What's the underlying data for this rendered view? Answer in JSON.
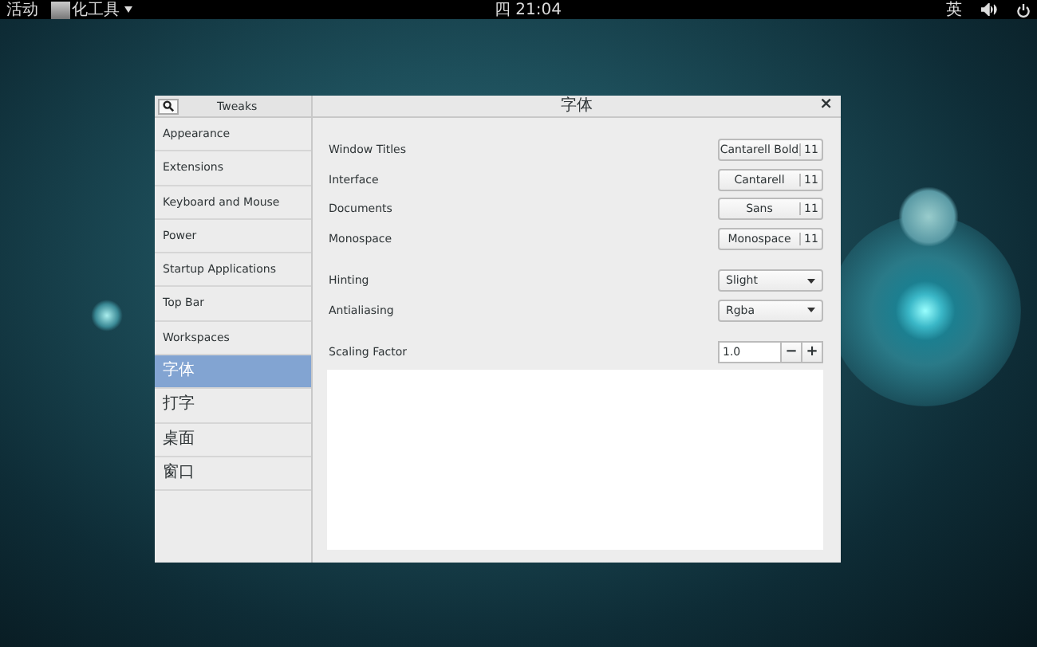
{
  "top_bar": {
    "activities": "活动",
    "app_menu": "化工具",
    "clock": "四 21:04",
    "input_method": "英"
  },
  "window": {
    "sidebar_title": "Tweaks",
    "title": "字体",
    "close": "×"
  },
  "sidebar": {
    "items": [
      {
        "label": "Appearance",
        "selected": false
      },
      {
        "label": "Extensions",
        "selected": false
      },
      {
        "label": "Keyboard and Mouse",
        "selected": false
      },
      {
        "label": "Power",
        "selected": false
      },
      {
        "label": "Startup Applications",
        "selected": false
      },
      {
        "label": "Top Bar",
        "selected": false
      },
      {
        "label": "Workspaces",
        "selected": false
      },
      {
        "label": "字体",
        "selected": true
      },
      {
        "label": "打字",
        "selected": false
      },
      {
        "label": "桌面",
        "selected": false
      },
      {
        "label": "窗口",
        "selected": false
      }
    ]
  },
  "settings": [
    {
      "kind": "font",
      "label": "Window Titles",
      "font": "Cantarell Bold",
      "size": "11"
    },
    {
      "kind": "font",
      "label": "Interface",
      "font": "Cantarell",
      "size": "11"
    },
    {
      "kind": "font",
      "label": "Documents",
      "font": "Sans",
      "size": "11"
    },
    {
      "kind": "font",
      "label": "Monospace",
      "font": "Monospace",
      "size": "11"
    },
    {
      "kind": "gap"
    },
    {
      "kind": "dropdown",
      "label": "Hinting",
      "value": "Slight"
    },
    {
      "kind": "dropdown",
      "label": "Antialiasing",
      "value": "Rgba"
    },
    {
      "kind": "gap"
    },
    {
      "kind": "spin",
      "label": "Scaling Factor",
      "value": "1.0",
      "minus": "−",
      "plus": "+"
    }
  ]
}
